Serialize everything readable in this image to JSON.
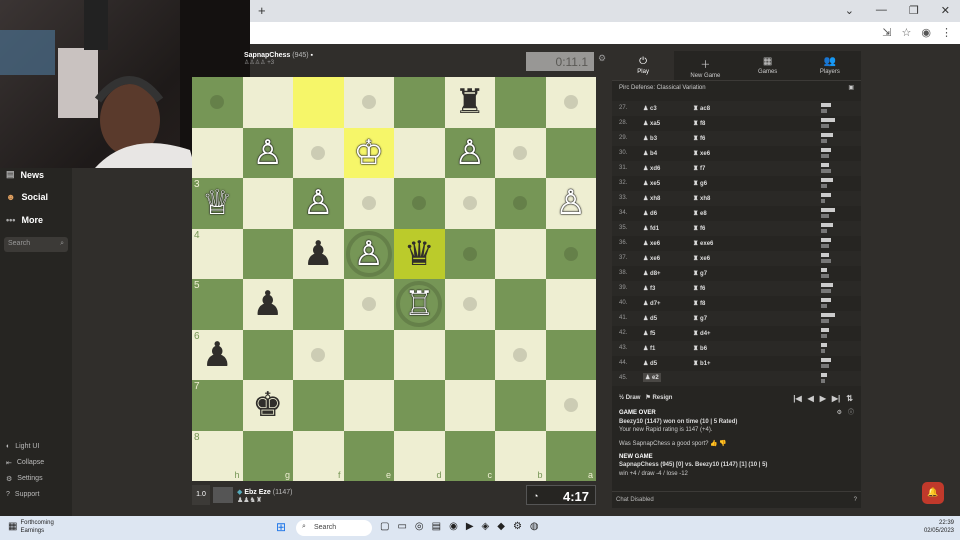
{
  "taskbar": {
    "weather_title": "Forthcoming",
    "weather_sub": "Earnings",
    "search": "Search",
    "time": "22:39",
    "date": "02/05/2023"
  },
  "sidebar": {
    "news": "News",
    "social": "Social",
    "more": "More",
    "search_placeholder": "Search",
    "light_ui": "Light UI",
    "collapse": "Collapse",
    "settings": "Settings",
    "support": "Support"
  },
  "top_player": {
    "name": "SapnapChess",
    "rating": "(945)",
    "material": "+3",
    "clock": "0:11.1"
  },
  "bottom_player": {
    "name": "Ebz Eze",
    "rating": "(1147)",
    "badge": "1.0",
    "clock": "4:17"
  },
  "board": {
    "ranks": [
      "3",
      "4",
      "5",
      "6",
      "7",
      "8"
    ],
    "files": [
      "h",
      "g",
      "f",
      "e",
      "d",
      "c",
      "b",
      "a"
    ],
    "pieces": [
      {
        "r": 0,
        "c": 5,
        "p": "♜",
        "color": "b"
      },
      {
        "r": 1,
        "c": 1,
        "p": "♙",
        "color": "w"
      },
      {
        "r": 1,
        "c": 3,
        "p": "♔",
        "color": "w"
      },
      {
        "r": 1,
        "c": 5,
        "p": "♙",
        "color": "w"
      },
      {
        "r": 2,
        "c": 0,
        "p": "♕",
        "color": "w"
      },
      {
        "r": 2,
        "c": 2,
        "p": "♙",
        "color": "w"
      },
      {
        "r": 2,
        "c": 7,
        "p": "♙",
        "color": "w"
      },
      {
        "r": 3,
        "c": 2,
        "p": "♟",
        "color": "b"
      },
      {
        "r": 3,
        "c": 3,
        "p": "♙",
        "color": "w"
      },
      {
        "r": 3,
        "c": 4,
        "p": "♛",
        "color": "b"
      },
      {
        "r": 4,
        "c": 1,
        "p": "♟",
        "color": "b"
      },
      {
        "r": 4,
        "c": 4,
        "p": "♖",
        "color": "w"
      },
      {
        "r": 5,
        "c": 0,
        "p": "♟",
        "color": "b"
      },
      {
        "r": 6,
        "c": 1,
        "p": "♚",
        "color": "b"
      }
    ],
    "highlights": [
      {
        "r": 0,
        "c": 2,
        "type": "hl"
      },
      {
        "r": 1,
        "c": 3,
        "type": "hl"
      },
      {
        "r": 3,
        "c": 4,
        "type": "hlk"
      }
    ],
    "dots": [
      [
        0,
        0
      ],
      [
        0,
        3
      ],
      [
        0,
        7
      ],
      [
        1,
        2
      ],
      [
        1,
        6
      ],
      [
        2,
        3
      ],
      [
        2,
        4
      ],
      [
        2,
        5
      ],
      [
        2,
        6
      ],
      [
        3,
        5
      ],
      [
        3,
        7
      ],
      [
        4,
        3
      ],
      [
        4,
        5
      ],
      [
        5,
        2
      ],
      [
        5,
        6
      ],
      [
        6,
        7
      ]
    ],
    "rings": [
      [
        3,
        3
      ],
      [
        4,
        4
      ]
    ]
  },
  "panel": {
    "tabs": [
      {
        "icon": "⏻",
        "label": "Play"
      },
      {
        "icon": "＋",
        "label": "New Game"
      },
      {
        "icon": "▦",
        "label": "Games"
      },
      {
        "icon": "👥",
        "label": "Players"
      }
    ],
    "opening": "Pirc Defense: Classical Variation",
    "moves": [
      {
        "n": "27.",
        "w": "c3",
        "b": "ac8"
      },
      {
        "n": "28.",
        "w": "xa5",
        "b": "f8"
      },
      {
        "n": "29.",
        "w": "b3",
        "b": "f6"
      },
      {
        "n": "30.",
        "w": "b4",
        "b": "xe6"
      },
      {
        "n": "31.",
        "w": "xd6",
        "b": "f7"
      },
      {
        "n": "32.",
        "w": "xe5",
        "b": "g6"
      },
      {
        "n": "33.",
        "w": "xh8",
        "b": "xh8"
      },
      {
        "n": "34.",
        "w": "d6",
        "b": "e8"
      },
      {
        "n": "35.",
        "w": "fd1",
        "b": "f6"
      },
      {
        "n": "36.",
        "w": "xe6",
        "b": "exe6"
      },
      {
        "n": "37.",
        "w": "xe6",
        "b": "xe6"
      },
      {
        "n": "38.",
        "w": "d8+",
        "b": "g7"
      },
      {
        "n": "39.",
        "w": "f3",
        "b": "f6"
      },
      {
        "n": "40.",
        "w": "d7+",
        "b": "f8"
      },
      {
        "n": "41.",
        "w": "d5",
        "b": "g7"
      },
      {
        "n": "42.",
        "w": "f5",
        "b": "d4+"
      },
      {
        "n": "43.",
        "w": "f1",
        "b": "b6"
      },
      {
        "n": "44.",
        "w": "d5",
        "b": "b1+"
      },
      {
        "n": "45.",
        "w": "e2",
        "b": ""
      }
    ],
    "draw": "Draw",
    "resign": "Resign",
    "game_over": "GAME OVER",
    "result": "Beezy10 (1147) won on time (10 | 5 Rated)",
    "rating_line": "Your new Rapid rating is 1147 (+4).",
    "sport_q": "Was SapnapChess a good sport?",
    "new_game": "NEW GAME",
    "matchup": "SapnapChess (945) [0] vs. Beezy10 (1147) [1] (10 | 5)",
    "stakes": "win +4 / draw -4 / lose -12",
    "chat_disabled": "Chat Disabled"
  }
}
